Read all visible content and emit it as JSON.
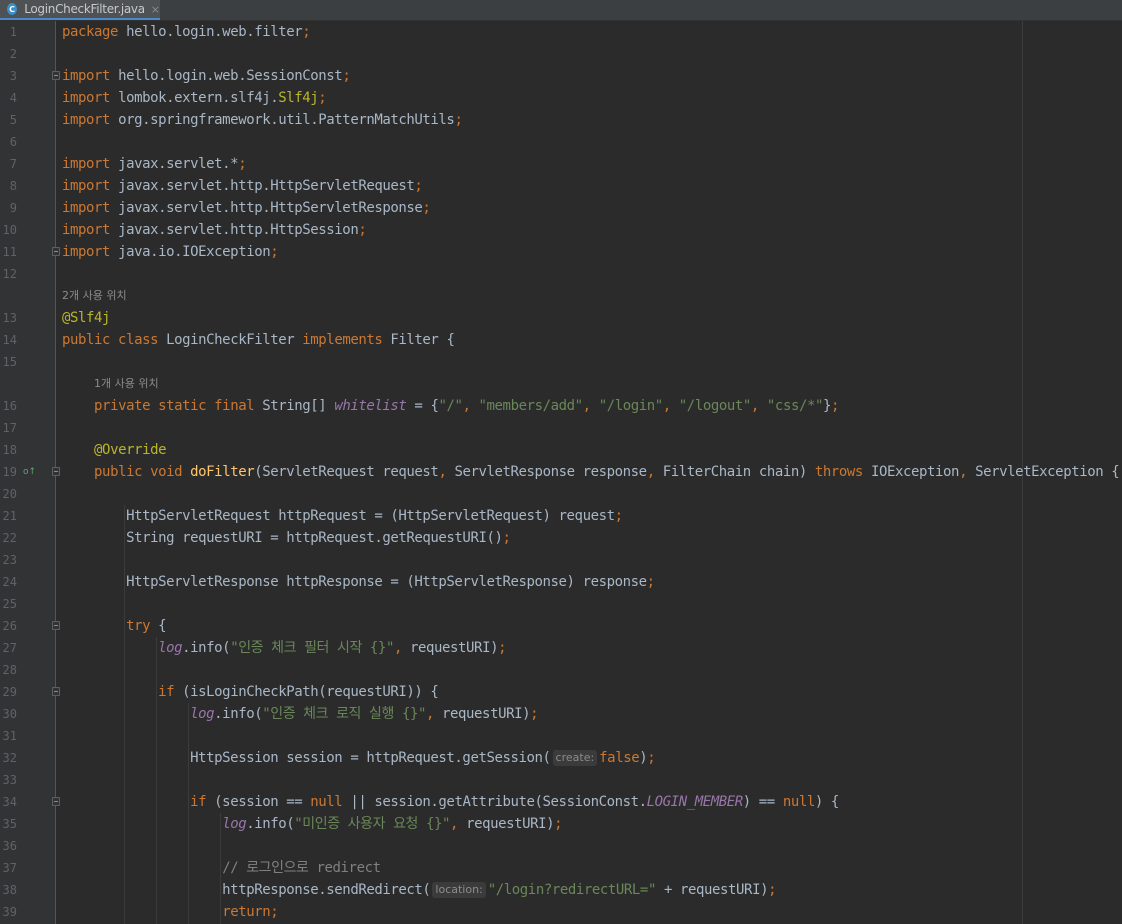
{
  "tab": {
    "title": "LoginCheckFilter.java",
    "icon": "C",
    "close": "×"
  },
  "usages": {
    "two": "2개 사용 위치",
    "one": "1개 사용 위치"
  },
  "lines": [
    {
      "n": "1",
      "segs": [
        {
          "c": "kw",
          "t": "package "
        },
        {
          "c": "",
          "t": "hello.login.web.filter"
        },
        {
          "c": "kw",
          "t": ";"
        }
      ]
    },
    {
      "n": "2",
      "segs": []
    },
    {
      "n": "3",
      "segs": [
        {
          "c": "kw",
          "t": "import "
        },
        {
          "c": "",
          "t": "hello.login.web.SessionConst"
        },
        {
          "c": "kw",
          "t": ";"
        }
      ]
    },
    {
      "n": "4",
      "segs": [
        {
          "c": "kw",
          "t": "import "
        },
        {
          "c": "",
          "t": "lombok.extern.slf4j."
        },
        {
          "c": "an",
          "t": "Slf4j"
        },
        {
          "c": "kw",
          "t": ";"
        }
      ]
    },
    {
      "n": "5",
      "segs": [
        {
          "c": "kw",
          "t": "import "
        },
        {
          "c": "",
          "t": "org.springframework.util.PatternMatchUtils"
        },
        {
          "c": "kw",
          "t": ";"
        }
      ]
    },
    {
      "n": "6",
      "segs": []
    },
    {
      "n": "7",
      "segs": [
        {
          "c": "kw",
          "t": "import "
        },
        {
          "c": "",
          "t": "javax.servlet.*"
        },
        {
          "c": "kw",
          "t": ";"
        }
      ]
    },
    {
      "n": "8",
      "segs": [
        {
          "c": "kw",
          "t": "import "
        },
        {
          "c": "",
          "t": "javax.servlet.http.HttpServletRequest"
        },
        {
          "c": "kw",
          "t": ";"
        }
      ]
    },
    {
      "n": "9",
      "segs": [
        {
          "c": "kw",
          "t": "import "
        },
        {
          "c": "",
          "t": "javax.servlet.http.HttpServletResponse"
        },
        {
          "c": "kw",
          "t": ";"
        }
      ]
    },
    {
      "n": "10",
      "segs": [
        {
          "c": "kw",
          "t": "import "
        },
        {
          "c": "",
          "t": "javax.servlet.http.HttpSession"
        },
        {
          "c": "kw",
          "t": ";"
        }
      ]
    },
    {
      "n": "11",
      "segs": [
        {
          "c": "kw",
          "t": "import "
        },
        {
          "c": "",
          "t": "java.io.IOException"
        },
        {
          "c": "kw",
          "t": ";"
        }
      ]
    },
    {
      "n": "12",
      "segs": []
    },
    {
      "n": "13",
      "segs": [
        {
          "c": "an",
          "t": "@Slf4j"
        }
      ]
    },
    {
      "n": "14",
      "segs": [
        {
          "c": "kw",
          "t": "public class "
        },
        {
          "c": "",
          "t": "LoginCheckFilter "
        },
        {
          "c": "kw",
          "t": "implements "
        },
        {
          "c": "",
          "t": "Filter {"
        }
      ]
    },
    {
      "n": "15",
      "segs": []
    },
    {
      "n": "16",
      "segs": [
        {
          "c": "",
          "t": "    "
        },
        {
          "c": "kw",
          "t": "private static final "
        },
        {
          "c": "",
          "t": "String[] "
        },
        {
          "c": "it",
          "t": "whitelist"
        },
        {
          "c": "",
          "t": " = {"
        },
        {
          "c": "st",
          "t": "\"/\""
        },
        {
          "c": "kw",
          "t": ", "
        },
        {
          "c": "st",
          "t": "\"members/add\""
        },
        {
          "c": "kw",
          "t": ", "
        },
        {
          "c": "st",
          "t": "\"/login\""
        },
        {
          "c": "kw",
          "t": ", "
        },
        {
          "c": "st",
          "t": "\"/logout\""
        },
        {
          "c": "kw",
          "t": ", "
        },
        {
          "c": "st",
          "t": "\"css/*\""
        },
        {
          "c": "",
          "t": "}"
        },
        {
          "c": "kw",
          "t": ";"
        }
      ]
    },
    {
      "n": "17",
      "segs": []
    },
    {
      "n": "18",
      "segs": [
        {
          "c": "",
          "t": "    "
        },
        {
          "c": "an",
          "t": "@Override"
        }
      ]
    },
    {
      "n": "19",
      "segs": [
        {
          "c": "",
          "t": "    "
        },
        {
          "c": "kw",
          "t": "public void "
        },
        {
          "c": "fn",
          "t": "doFilter"
        },
        {
          "c": "",
          "t": "(ServletRequest request"
        },
        {
          "c": "kw",
          "t": ", "
        },
        {
          "c": "",
          "t": "ServletResponse response"
        },
        {
          "c": "kw",
          "t": ", "
        },
        {
          "c": "",
          "t": "FilterChain chain) "
        },
        {
          "c": "kw",
          "t": "throws "
        },
        {
          "c": "",
          "t": "IOException"
        },
        {
          "c": "kw",
          "t": ", "
        },
        {
          "c": "",
          "t": "ServletException {"
        }
      ]
    },
    {
      "n": "20",
      "segs": []
    },
    {
      "n": "21",
      "segs": [
        {
          "c": "",
          "t": "        HttpServletRequest httpRequest = (HttpServletRequest) request"
        },
        {
          "c": "kw",
          "t": ";"
        }
      ]
    },
    {
      "n": "22",
      "segs": [
        {
          "c": "",
          "t": "        String requestURI = httpRequest.getRequestURI()"
        },
        {
          "c": "kw",
          "t": ";"
        }
      ]
    },
    {
      "n": "23",
      "segs": []
    },
    {
      "n": "24",
      "segs": [
        {
          "c": "",
          "t": "        HttpServletResponse httpResponse = (HttpServletResponse) response"
        },
        {
          "c": "kw",
          "t": ";"
        }
      ]
    },
    {
      "n": "25",
      "segs": []
    },
    {
      "n": "26",
      "segs": [
        {
          "c": "",
          "t": "        "
        },
        {
          "c": "kw",
          "t": "try "
        },
        {
          "c": "",
          "t": "{"
        }
      ]
    },
    {
      "n": "27",
      "segs": [
        {
          "c": "",
          "t": "            "
        },
        {
          "c": "it",
          "t": "log"
        },
        {
          "c": "",
          "t": ".info("
        },
        {
          "c": "st",
          "t": "\"인증 체크 필터 시작 {}\""
        },
        {
          "c": "kw",
          "t": ", "
        },
        {
          "c": "",
          "t": "requestURI)"
        },
        {
          "c": "kw",
          "t": ";"
        }
      ]
    },
    {
      "n": "28",
      "segs": []
    },
    {
      "n": "29",
      "segs": [
        {
          "c": "",
          "t": "            "
        },
        {
          "c": "kw",
          "t": "if "
        },
        {
          "c": "",
          "t": "(isLoginCheckPath(requestURI)) {"
        }
      ]
    },
    {
      "n": "30",
      "segs": [
        {
          "c": "",
          "t": "                "
        },
        {
          "c": "it",
          "t": "log"
        },
        {
          "c": "",
          "t": ".info("
        },
        {
          "c": "st",
          "t": "\"인증 체크 로직 실행 {}\""
        },
        {
          "c": "kw",
          "t": ", "
        },
        {
          "c": "",
          "t": "requestURI)"
        },
        {
          "c": "kw",
          "t": ";"
        }
      ]
    },
    {
      "n": "31",
      "segs": []
    },
    {
      "n": "32",
      "segs": [
        {
          "c": "",
          "t": "                HttpSession session = httpRequest.getSession("
        },
        {
          "c": "hint",
          "t": "create:"
        },
        {
          "c": "kw",
          "t": "false"
        },
        {
          "c": "",
          "t": ")"
        },
        {
          "c": "kw",
          "t": ";"
        }
      ]
    },
    {
      "n": "33",
      "segs": []
    },
    {
      "n": "34",
      "segs": [
        {
          "c": "",
          "t": "                "
        },
        {
          "c": "kw",
          "t": "if "
        },
        {
          "c": "",
          "t": "(session == "
        },
        {
          "c": "kw",
          "t": "null "
        },
        {
          "c": "",
          "t": "|| session.getAttribute(SessionConst."
        },
        {
          "c": "it",
          "t": "LOGIN_MEMBER"
        },
        {
          "c": "",
          "t": ") == "
        },
        {
          "c": "kw",
          "t": "null"
        },
        {
          "c": "",
          "t": ") {"
        }
      ]
    },
    {
      "n": "35",
      "segs": [
        {
          "c": "",
          "t": "                    "
        },
        {
          "c": "it",
          "t": "log"
        },
        {
          "c": "",
          "t": ".info("
        },
        {
          "c": "st",
          "t": "\"미인증 사용자 요청 {}\""
        },
        {
          "c": "kw",
          "t": ", "
        },
        {
          "c": "",
          "t": "requestURI)"
        },
        {
          "c": "kw",
          "t": ";"
        }
      ]
    },
    {
      "n": "36",
      "segs": []
    },
    {
      "n": "37",
      "segs": [
        {
          "c": "",
          "t": "                    "
        },
        {
          "c": "cm",
          "t": "// 로그인으로 redirect"
        }
      ]
    },
    {
      "n": "38",
      "segs": [
        {
          "c": "",
          "t": "                    httpResponse.sendRedirect("
        },
        {
          "c": "hint",
          "t": "location:"
        },
        {
          "c": "st",
          "t": "\"/login?redirectURL=\" "
        },
        {
          "c": "",
          "t": "+ requestURI)"
        },
        {
          "c": "kw",
          "t": ";"
        }
      ]
    },
    {
      "n": "39",
      "segs": [
        {
          "c": "",
          "t": "                    "
        },
        {
          "c": "kw",
          "t": "return;"
        }
      ]
    }
  ]
}
